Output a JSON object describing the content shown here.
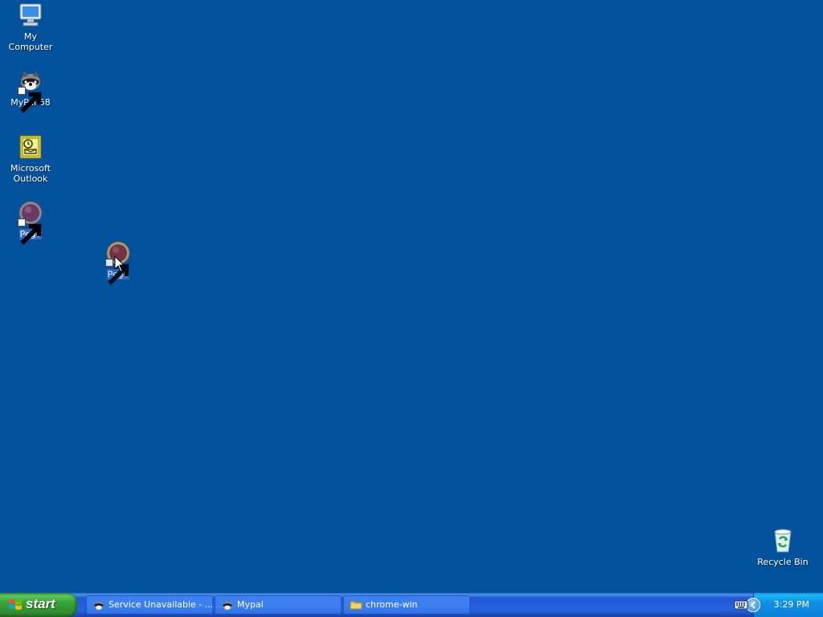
{
  "desktop": {
    "background": "#00529c",
    "icons": [
      {
        "label": "My Computer",
        "icon": "computer-icon"
      },
      {
        "label": "MyPal 68",
        "icon": "mypal-icon",
        "shortcut": true
      },
      {
        "label": "Microsoft Outlook",
        "icon": "outlook-icon"
      },
      {
        "label": "Pego",
        "icon": "pego-icon",
        "shortcut": true,
        "selected": true
      },
      {
        "label": "Pego",
        "icon": "pego-icon",
        "shortcut": true,
        "selected": true,
        "dragging": true
      },
      {
        "label": "Recycle Bin",
        "icon": "recycle-bin-icon"
      }
    ]
  },
  "taskbar": {
    "start_label": "start",
    "tasks": [
      {
        "label": "Service Unavailable - ...",
        "icon": "mypal-icon"
      },
      {
        "label": "Mypal",
        "icon": "mypal-icon"
      },
      {
        "label": "chrome-win",
        "icon": "folder-icon"
      }
    ],
    "clock": "3:29 PM"
  }
}
